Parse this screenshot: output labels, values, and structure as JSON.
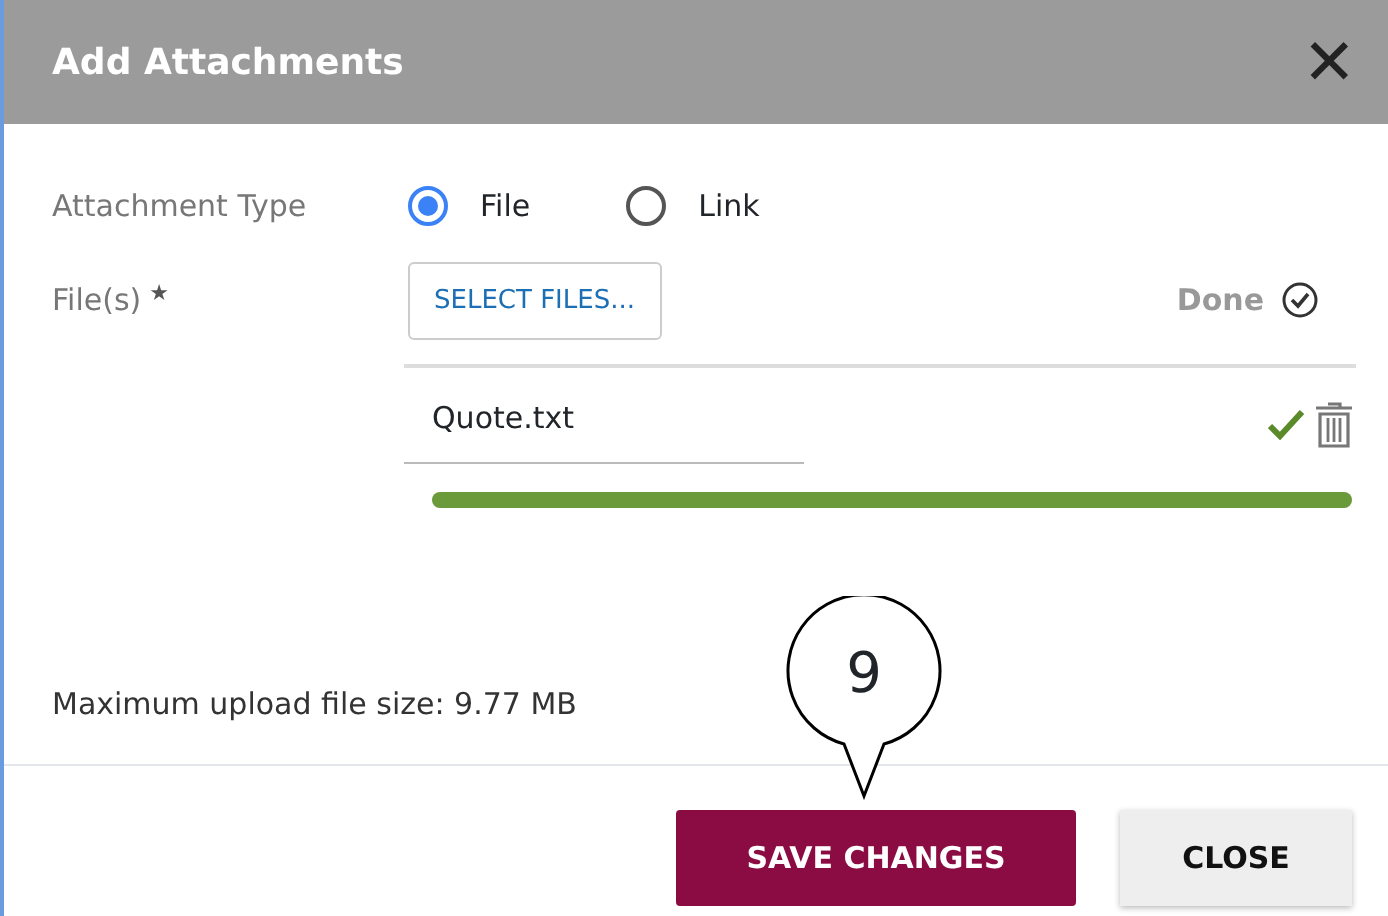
{
  "dialog": {
    "title": "Add Attachments",
    "close_icon": "✕"
  },
  "attachment_type": {
    "label": "Attachment Type",
    "options": [
      {
        "label": "File",
        "selected": true
      },
      {
        "label": "Link",
        "selected": false
      }
    ]
  },
  "files": {
    "label": "File(s)",
    "required_mark": "★",
    "select_button": "SELECT FILES...",
    "status": "Done",
    "items": [
      {
        "name": "Quote.txt",
        "uploaded": true,
        "level": 1
      }
    ]
  },
  "max_size_note": "Maximum upload file size: 9.77 MB",
  "callout": "9",
  "buttons": [
    {
      "label": "SAVE CHANGES",
      "kind": "primary"
    },
    {
      "label": "CLOSE",
      "kind": "secondary"
    }
  ]
}
